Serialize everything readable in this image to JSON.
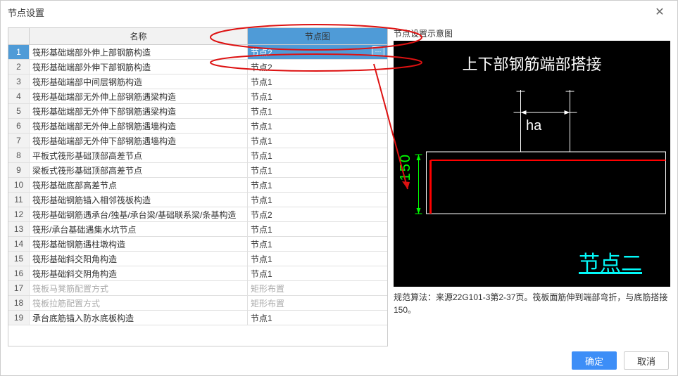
{
  "title": "节点设置",
  "cols": {
    "name": "名称",
    "val": "节点图"
  },
  "rows": [
    {
      "name": "筏形基础端部外伸上部钢筋构造",
      "val": "节点2",
      "sel": true
    },
    {
      "name": "筏形基础端部外伸下部钢筋构造",
      "val": "节点2"
    },
    {
      "name": "筏形基础端部中间层钢筋构造",
      "val": "节点1"
    },
    {
      "name": "筏形基础端部无外伸上部钢筋遇梁构造",
      "val": "节点1"
    },
    {
      "name": "筏形基础端部无外伸下部钢筋遇梁构造",
      "val": "节点1"
    },
    {
      "name": "筏形基础端部无外伸上部钢筋遇墙构造",
      "val": "节点1"
    },
    {
      "name": "筏形基础端部无外伸下部钢筋遇墙构造",
      "val": "节点1"
    },
    {
      "name": "平板式筏形基础顶部高差节点",
      "val": "节点1"
    },
    {
      "name": "梁板式筏形基础顶部高差节点",
      "val": "节点1"
    },
    {
      "name": "筏形基础底部高差节点",
      "val": "节点1"
    },
    {
      "name": "筏形基础钢筋锚入相邻筏板构造",
      "val": "节点1"
    },
    {
      "name": "筏形基础钢筋遇承台/独基/承台梁/基础联系梁/条基构造",
      "val": "节点2"
    },
    {
      "name": "筏形/承台基础遇集水坑节点",
      "val": "节点1"
    },
    {
      "name": "筏形基础钢筋遇柱墩构造",
      "val": "节点1"
    },
    {
      "name": "筏形基础斜交阳角构造",
      "val": "节点1"
    },
    {
      "name": "筏形基础斜交阴角构造",
      "val": "节点1"
    },
    {
      "name": "筏板马凳筋配置方式",
      "val": "矩形布置",
      "disabled": true
    },
    {
      "name": "筏板拉筋配置方式",
      "val": "矩形布置",
      "disabled": true
    },
    {
      "name": "承台底筋锚入防水底板构造",
      "val": "节点1"
    }
  ],
  "preview": {
    "label": "节点设置示意图",
    "dtitle": "上下部钢筋端部搭接",
    "v150": "150",
    "tha": "ha",
    "dnode": "节点二",
    "note": "规范算法：来源22G101-3第2-37页。筏板面筋伸到端部弯折，与底筋搭接 150。"
  },
  "buttons": {
    "ok": "确定",
    "cancel": "取消"
  }
}
